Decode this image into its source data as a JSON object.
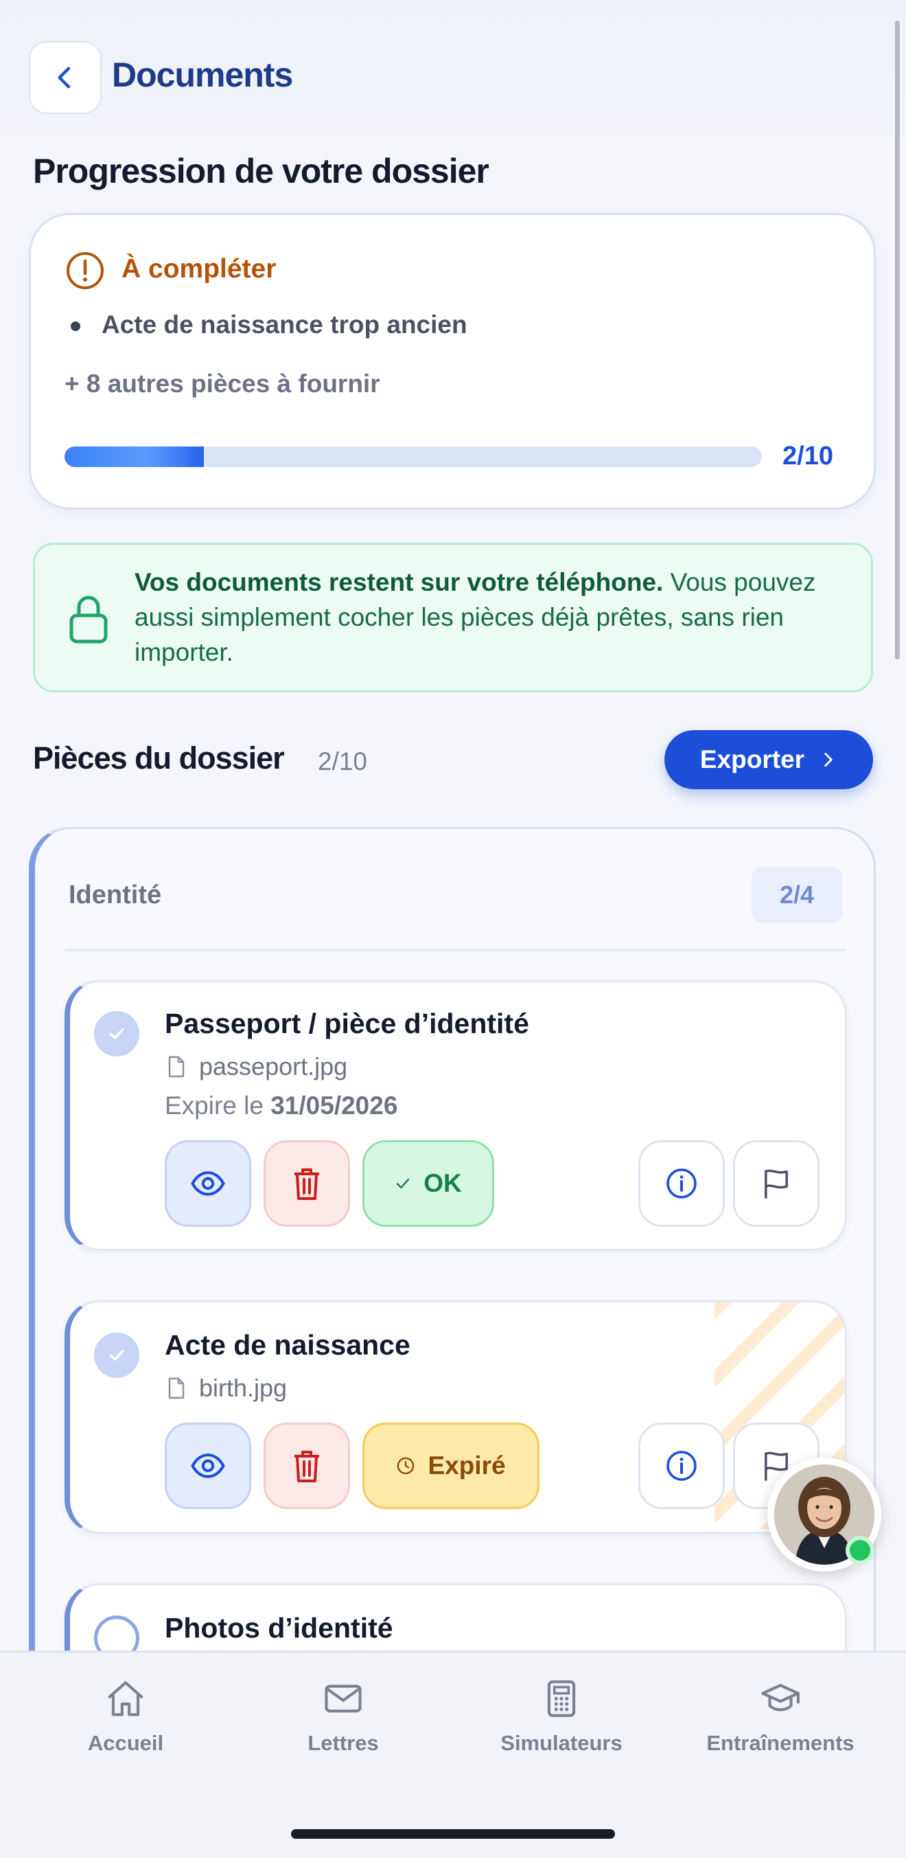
{
  "header": {
    "title": "Documents",
    "back_icon": "chevron-left-icon"
  },
  "progress": {
    "section_title": "Progression de votre dossier",
    "status_label": "À compléter",
    "missing_items": [
      "Acte de naissance trop ancien"
    ],
    "more_label": "+ 8 autres pièces à fournir",
    "count_label": "2/10",
    "completed_fraction": 0.2
  },
  "privacy": {
    "bold_text": "Vos documents restent sur votre téléphone.",
    "text": " Vous pouvez aussi simplement cocher les pièces déjà prêtes, sans rien importer."
  },
  "pieces": {
    "title": "Pièces du dossier",
    "count": "2/10",
    "export_label": "Exporter"
  },
  "group": {
    "label": "Identité",
    "badge": "2/4",
    "documents": [
      {
        "title": "Passeport / pièce d’identité",
        "file": "passeport.jpg",
        "expire_prefix": "Expire le ",
        "expire_date": "31/05/2026",
        "status": "OK"
      },
      {
        "title": "Acte de naissance",
        "file": "birth.jpg",
        "status": "Expiré"
      },
      {
        "title": "Photos d’identité"
      }
    ]
  },
  "nav": {
    "items": [
      {
        "label": "Accueil",
        "icon": "home-icon"
      },
      {
        "label": "Lettres",
        "icon": "mail-icon"
      },
      {
        "label": "Simulateurs",
        "icon": "calculator-icon"
      },
      {
        "label": "Entraînements",
        "icon": "graduation-cap-icon"
      }
    ]
  },
  "colors": {
    "accent": "#1d4ed8",
    "warning": "#b45309",
    "success": "#17804a",
    "expired_bg": "#fde9a8"
  }
}
